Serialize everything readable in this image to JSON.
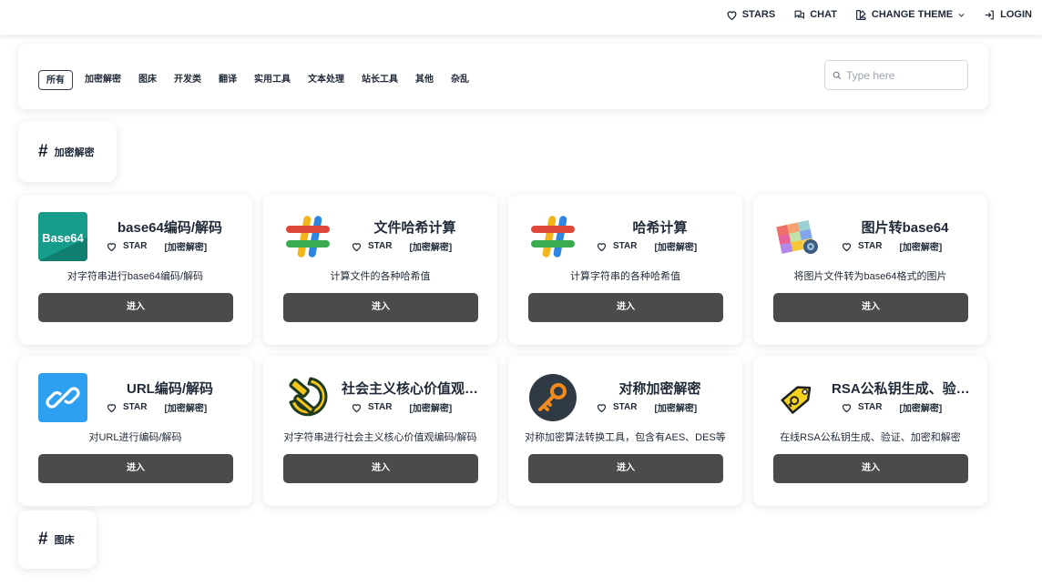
{
  "nav": {
    "stars": "STARS",
    "chat": "CHAT",
    "theme": "CHANGE THEME",
    "login": "LOGIN"
  },
  "filter": {
    "categories": [
      "所有",
      "加密解密",
      "图床",
      "开发类",
      "翻译",
      "实用工具",
      "文本处理",
      "站长工具",
      "其他",
      "杂乱"
    ],
    "active": 0,
    "search_placeholder": "Type here"
  },
  "sections": [
    {
      "hash": "#",
      "title": "加密解密"
    },
    {
      "hash": "#",
      "title": "图床"
    }
  ],
  "cards": [
    {
      "icon": "base64-icon",
      "icon_text": "Base64",
      "title": "base64编码/解码",
      "star": "STAR",
      "tag": "[加密解密]",
      "desc": "对字符串进行base64编码/解码",
      "button": "进入"
    },
    {
      "icon": "hash-icon",
      "title": "文件哈希计算",
      "star": "STAR",
      "tag": "[加密解密]",
      "desc": "计算文件的各种哈希值",
      "button": "进入"
    },
    {
      "icon": "hash-icon",
      "title": "哈希计算",
      "star": "STAR",
      "tag": "[加密解密]",
      "desc": "计算字符串的各种哈希值",
      "button": "进入"
    },
    {
      "icon": "image-icon",
      "title": "图片转base64",
      "star": "STAR",
      "tag": "[加密解密]",
      "desc": "将图片文件转为base64格式的图片",
      "button": "进入"
    },
    {
      "icon": "link-icon",
      "title": "URL编码/解码",
      "star": "STAR",
      "tag": "[加密解密]",
      "desc": "对URL进行编码/解码",
      "button": "进入"
    },
    {
      "icon": "hammer-sickle-icon",
      "title": "社会主义核心价值观编码/解码",
      "star": "STAR",
      "tag": "[加密解密]",
      "desc": "对字符串进行社会主义核心价值观编码/解码",
      "button": "进入"
    },
    {
      "icon": "key-icon",
      "title": "对称加密解密",
      "star": "STAR",
      "tag": "[加密解密]",
      "desc": "对称加密算法转换工具，包含有AES、DES等",
      "button": "进入"
    },
    {
      "icon": "tag-key-icon",
      "title": "RSA公私钥生成、验证、加密和解密",
      "star": "STAR",
      "tag": "[加密解密]",
      "desc": "在线RSA公私钥生成、验证、加密和解密",
      "button": "进入"
    }
  ],
  "colors": {
    "button_bg": "#4b4b4b",
    "base64_bg": "#169c8a",
    "link_bg": "#2ea0f2",
    "key_bg": "#2f3a44",
    "key_fg": "#f28b1e"
  }
}
